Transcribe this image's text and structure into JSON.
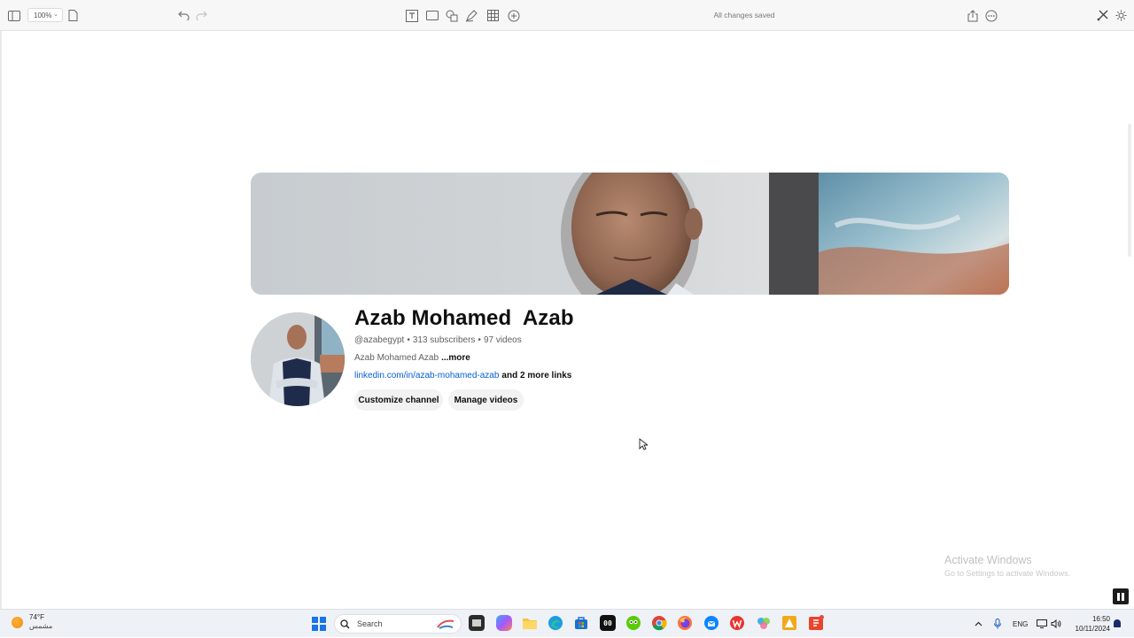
{
  "toolbar": {
    "zoom_value": "100%",
    "status": "All changes saved"
  },
  "channel": {
    "name": "Azab Mohamed  Azab",
    "handle": "@azabegypt",
    "subscribers": "313 subscribers",
    "videos": "97 videos",
    "description": "Azab Mohamed Azab",
    "more_label": "...more",
    "link": "linkedin.com/in/azab-mohamed-azab",
    "more_links": "and 2 more links",
    "buttons": {
      "customize": "Customize channel",
      "manage": "Manage videos"
    }
  },
  "watermark": {
    "line1": "Activate Windows",
    "line2": "Go to Settings to activate Windows."
  },
  "taskbar": {
    "weather_temp": "74°F",
    "weather_condition": "مشمس",
    "search_label": "Search",
    "language": "ENG",
    "time": "16:50",
    "date": "10/11/2024",
    "apps": [
      "file-explorer-dark",
      "copilot",
      "folder",
      "edge",
      "store",
      "oo-app",
      "duolingo",
      "chrome",
      "firefox",
      "thunderbird",
      "wps",
      "colorful-app",
      "orange-app",
      "slides-app"
    ]
  },
  "colors": {
    "link": "#065fd4",
    "accent": "#1a73e8"
  }
}
